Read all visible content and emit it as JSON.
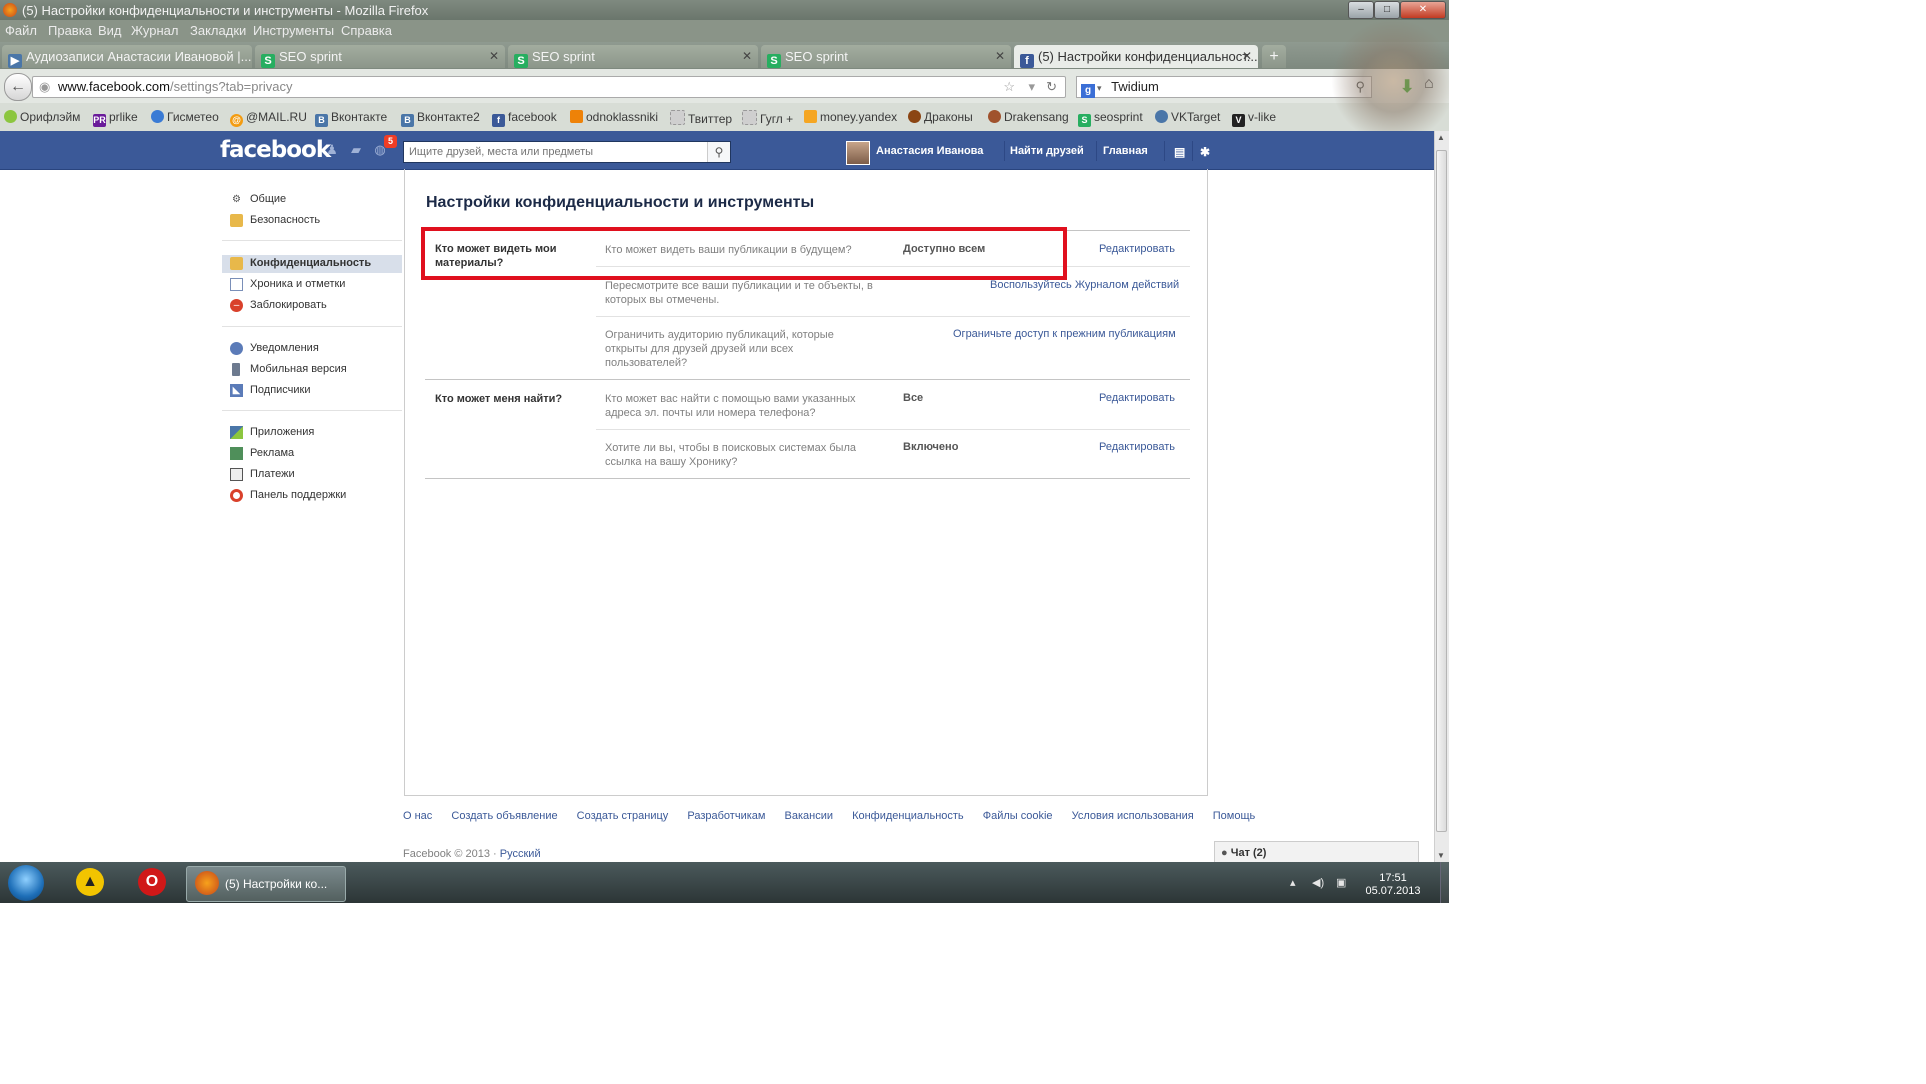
{
  "window": {
    "title": "(5) Настройки конфиденциальности и инструменты - Mozilla Firefox"
  },
  "menu": [
    "Файл",
    "Правка",
    "Вид",
    "Журнал",
    "Закладки",
    "Инструменты",
    "Справка"
  ],
  "tabs": [
    {
      "label": "Аудиозаписи Анастасии Ивановой |...",
      "icon": "play-icon",
      "active": false
    },
    {
      "label": "SEO sprint",
      "icon": "seosprint-icon",
      "active": false
    },
    {
      "label": "SEO sprint",
      "icon": "seosprint-icon",
      "active": false
    },
    {
      "label": "SEO sprint",
      "icon": "seosprint-icon",
      "active": false
    },
    {
      "label": "(5) Настройки конфиденциальност...",
      "icon": "facebook-icon",
      "active": true
    }
  ],
  "url": {
    "domain": "www.facebook.com",
    "path": "/settings?tab=privacy"
  },
  "search_engine": "Twidium",
  "bookmarks": [
    {
      "label": "Орифлэйм",
      "color": "#8cc63f"
    },
    {
      "label": "prlike",
      "badge": "PR",
      "color": "#6a1b9a"
    },
    {
      "label": "Гисметео",
      "color": "#3a7bd5"
    },
    {
      "label": "@MAIL.RU",
      "color": "#f39c12"
    },
    {
      "label": "Вконтакте",
      "badge": "B",
      "color": "#4a76a8"
    },
    {
      "label": "Вконтакте2",
      "badge": "B",
      "color": "#4a76a8"
    },
    {
      "label": "facebook",
      "badge": "f",
      "color": "#3b5998"
    },
    {
      "label": "odnoklassniki",
      "color": "#ee8208"
    },
    {
      "label": "Твиттер",
      "color": "#999999"
    },
    {
      "label": "Гугл +",
      "color": "#999999"
    },
    {
      "label": "money.yandex",
      "color": "#f5a623"
    },
    {
      "label": "Драконы",
      "color": "#8b4513"
    },
    {
      "label": "Drakensang",
      "color": "#a0522d"
    },
    {
      "label": "seosprint",
      "color": "#27ae60"
    },
    {
      "label": "VKTarget",
      "color": "#4a76a8"
    },
    {
      "label": "v-like",
      "badge": "V",
      "color": "#222222"
    }
  ],
  "fb": {
    "logo": "facebook",
    "notif_count": "5",
    "search_placeholder": "Ищите друзей, места или предметы",
    "user_name": "Анастасия Иванова",
    "find_friends": "Найти друзей",
    "home": "Главная"
  },
  "left_nav": [
    {
      "label": "Общие",
      "icon": "gears-icon",
      "selected": false
    },
    {
      "label": "Безопасность",
      "icon": "shield-icon",
      "selected": false
    },
    {
      "label": "Конфиденциальность",
      "icon": "lock-icon",
      "selected": true
    },
    {
      "label": "Хроника и отметки",
      "icon": "timeline-icon",
      "selected": false
    },
    {
      "label": "Заблокировать",
      "icon": "block-icon",
      "selected": false
    },
    {
      "label": "Уведомления",
      "icon": "globe-icon",
      "selected": false
    },
    {
      "label": "Мобильная версия",
      "icon": "mobile-icon",
      "selected": false
    },
    {
      "label": "Подписчики",
      "icon": "rss-icon",
      "selected": false
    },
    {
      "label": "Приложения",
      "icon": "apps-icon",
      "selected": false
    },
    {
      "label": "Реклама",
      "icon": "ads-icon",
      "selected": false
    },
    {
      "label": "Платежи",
      "icon": "card-icon",
      "selected": false
    },
    {
      "label": "Панель поддержки",
      "icon": "support-icon",
      "selected": false
    }
  ],
  "page": {
    "title": "Настройки конфиденциальности и инструменты",
    "sections": [
      {
        "label": "Кто может видеть мои материалы?",
        "rows": [
          {
            "desc": "Кто может видеть ваши публикации в будущем?",
            "value": "Доступно всем",
            "action": "Редактировать"
          },
          {
            "desc": "Пересмотрите все ваши публикации и те объекты, в которых вы отмечены.",
            "value": "",
            "action": "Воспользуйтесь Журналом действий"
          },
          {
            "desc": "Ограничить аудиторию публикаций, которые открыты для друзей друзей или всех пользователей?",
            "value": "",
            "action": "Ограничьте доступ к прежним публикациям"
          }
        ]
      },
      {
        "label": "Кто может меня найти?",
        "rows": [
          {
            "desc": "Кто может вас найти с помощью вами указанных адреса эл. почты или номера телефона?",
            "value": "Все",
            "action": "Редактировать"
          },
          {
            "desc": "Хотите ли вы, чтобы в поисковых системах была ссылка на вашу Хронику?",
            "value": "Включено",
            "action": "Редактировать"
          }
        ]
      }
    ]
  },
  "footer": {
    "links": [
      "О нас",
      "Создать объявление",
      "Создать страницу",
      "Разработчикам",
      "Вакансии",
      "Конфиденциальность",
      "Файлы cookie",
      "Условия использования",
      "Помощь"
    ],
    "copyright": "Facebook © 2013 ·",
    "language": "Русский"
  },
  "chat": {
    "label": "Чат (2)"
  },
  "taskbar": {
    "firefox_task": "(5) Настройки ко...",
    "time": "17:51",
    "date": "05.07.2013"
  },
  "colors": {
    "fb_blue": "#3b5998",
    "highlight_red": "#e0101e",
    "link": "#3b5998"
  }
}
